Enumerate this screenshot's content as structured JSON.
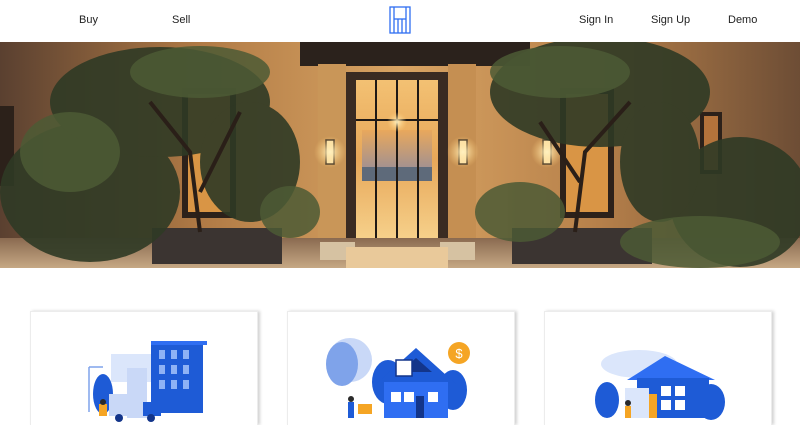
{
  "nav": {
    "left_links": [
      "Buy",
      "Sell"
    ],
    "right_links": [
      "Sign In",
      "Sign Up",
      "Demo"
    ],
    "logo_icon": "h-monogram-icon"
  },
  "hero": {
    "icon": "luxury-home-entrance-photo"
  },
  "cards": [
    {
      "icon": "city-building-moving-truck-illustration"
    },
    {
      "icon": "house-sale-dollar-illustration"
    },
    {
      "icon": "modern-home-illustration"
    }
  ],
  "colors": {
    "brand_blue": "#1e5bd6",
    "accent_blue": "#2f6ef2",
    "coin_orange": "#f5a524"
  }
}
